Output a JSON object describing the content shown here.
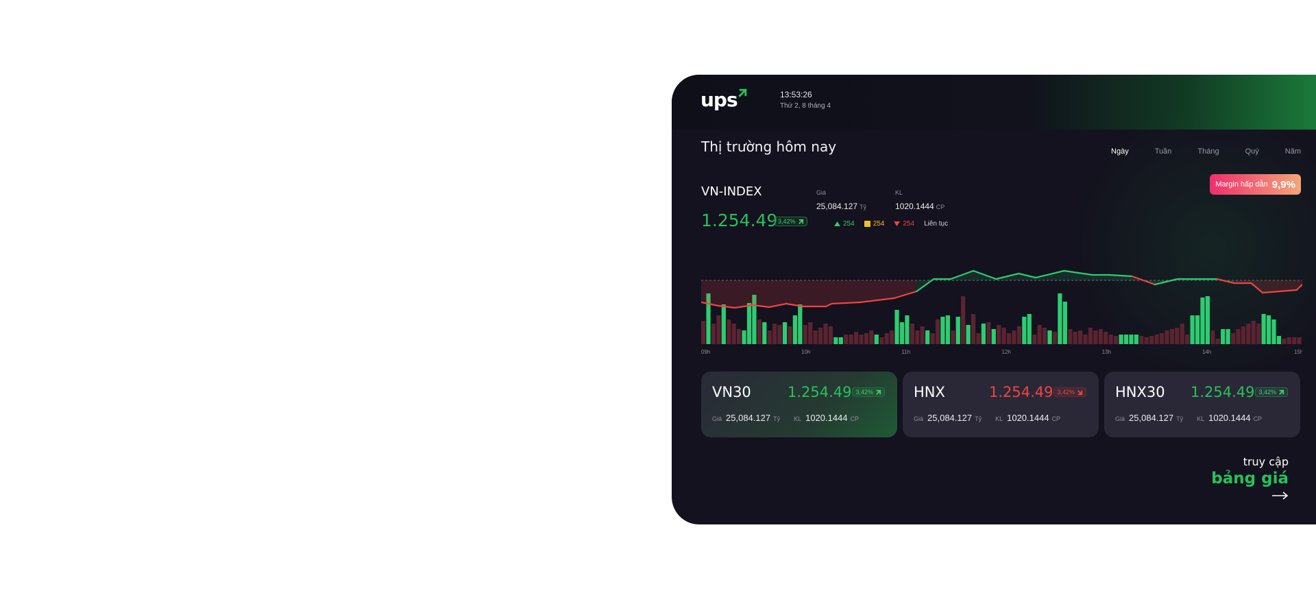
{
  "brand": {
    "logo_text": "ups"
  },
  "header": {
    "time": "13:53:26",
    "date": "Thứ 2, 8 tháng 4"
  },
  "section_title": "Thị trường hôm nay",
  "tabs": [
    {
      "label": "Ngày",
      "active": true
    },
    {
      "label": "Tuần",
      "active": false
    },
    {
      "label": "Tháng",
      "active": false
    },
    {
      "label": "Quý",
      "active": false
    },
    {
      "label": "Năm",
      "active": false
    }
  ],
  "margin_badge": {
    "label": "Margin hấp dẫn",
    "value": "9,9%"
  },
  "main_index": {
    "name": "VN-INDEX",
    "value": "1.254.49",
    "change": "3,42%",
    "direction": "up",
    "price_label": "Giá",
    "price_value": "25,084.127",
    "price_unit": "Tỷ",
    "volume_label": "KL",
    "volume_value": "1020.1444",
    "volume_unit": "CP",
    "up_count": "254",
    "flat_count": "254",
    "down_count": "254",
    "mode_label": "Liên tục"
  },
  "colors": {
    "up": "#2ecc71",
    "down": "#ef4444",
    "flat": "#f4c020",
    "accent": "#27c15b"
  },
  "chart_data": {
    "type": "line",
    "x_ticks": [
      "09h",
      "10h",
      "11h",
      "12h",
      "13h",
      "14h",
      "15h"
    ],
    "reference_line": "dashed",
    "price_line": [
      {
        "x": 0,
        "y": 32,
        "c": "d"
      },
      {
        "x": 3,
        "y": 37,
        "c": "d"
      },
      {
        "x": 6,
        "y": 40,
        "c": "d"
      },
      {
        "x": 9,
        "y": 36,
        "c": "d"
      },
      {
        "x": 12,
        "y": 39,
        "c": "d"
      },
      {
        "x": 15,
        "y": 34,
        "c": "d"
      },
      {
        "x": 18,
        "y": 38,
        "c": "d"
      },
      {
        "x": 22,
        "y": 38,
        "c": "d"
      },
      {
        "x": 23,
        "y": 34,
        "c": "d"
      },
      {
        "x": 28,
        "y": 32,
        "c": "d"
      },
      {
        "x": 34,
        "y": 26,
        "c": "d"
      },
      {
        "x": 38,
        "y": 16,
        "c": "d"
      },
      {
        "x": 41,
        "y": -2,
        "c": "u"
      },
      {
        "x": 44,
        "y": -2,
        "c": "u"
      },
      {
        "x": 48,
        "y": -14,
        "c": "u"
      },
      {
        "x": 52,
        "y": -2,
        "c": "u"
      },
      {
        "x": 56,
        "y": -10,
        "c": "u"
      },
      {
        "x": 59,
        "y": -4,
        "c": "u"
      },
      {
        "x": 64,
        "y": -14,
        "c": "u"
      },
      {
        "x": 69,
        "y": -8,
        "c": "u"
      },
      {
        "x": 72,
        "y": -8,
        "c": "u"
      },
      {
        "x": 76,
        "y": -6,
        "c": "u"
      },
      {
        "x": 80,
        "y": 6,
        "c": "d"
      },
      {
        "x": 84,
        "y": -2,
        "c": "u"
      },
      {
        "x": 88,
        "y": -2,
        "c": "u"
      },
      {
        "x": 91,
        "y": -2,
        "c": "u"
      },
      {
        "x": 94,
        "y": 4,
        "c": "d"
      },
      {
        "x": 97,
        "y": 4,
        "c": "d"
      },
      {
        "x": 99,
        "y": 18,
        "c": "d"
      },
      {
        "x": 102,
        "y": 16,
        "c": "d"
      },
      {
        "x": 105,
        "y": 14,
        "c": "d"
      },
      {
        "x": 106,
        "y": 6,
        "c": "d"
      }
    ],
    "volume": [
      {
        "v": 34,
        "c": "d"
      },
      {
        "v": 74,
        "c": "u"
      },
      {
        "v": 30,
        "c": "d"
      },
      {
        "v": 42,
        "c": "d"
      },
      {
        "v": 58,
        "c": "u"
      },
      {
        "v": 36,
        "c": "d"
      },
      {
        "v": 30,
        "c": "d"
      },
      {
        "v": 22,
        "c": "d"
      },
      {
        "v": 20,
        "c": "u"
      },
      {
        "v": 60,
        "c": "u"
      },
      {
        "v": 72,
        "c": "u"
      },
      {
        "v": 36,
        "c": "d"
      },
      {
        "v": 32,
        "c": "u"
      },
      {
        "v": 20,
        "c": "d"
      },
      {
        "v": 30,
        "c": "d"
      },
      {
        "v": 28,
        "c": "d"
      },
      {
        "v": 32,
        "c": "u"
      },
      {
        "v": 26,
        "c": "d"
      },
      {
        "v": 42,
        "c": "u"
      },
      {
        "v": 58,
        "c": "u"
      },
      {
        "v": 28,
        "c": "d"
      },
      {
        "v": 32,
        "c": "d"
      },
      {
        "v": 20,
        "c": "d"
      },
      {
        "v": 24,
        "c": "d"
      },
      {
        "v": 30,
        "c": "d"
      },
      {
        "v": 26,
        "c": "d"
      },
      {
        "v": 10,
        "c": "u"
      },
      {
        "v": 10,
        "c": "u"
      },
      {
        "v": 14,
        "c": "d"
      },
      {
        "v": 14,
        "c": "d"
      },
      {
        "v": 18,
        "c": "d"
      },
      {
        "v": 14,
        "c": "d"
      },
      {
        "v": 16,
        "c": "d"
      },
      {
        "v": 20,
        "c": "d"
      },
      {
        "v": 14,
        "c": "u"
      },
      {
        "v": 10,
        "c": "d"
      },
      {
        "v": 16,
        "c": "d"
      },
      {
        "v": 20,
        "c": "d"
      },
      {
        "v": 50,
        "c": "u"
      },
      {
        "v": 32,
        "c": "u"
      },
      {
        "v": 42,
        "c": "u"
      },
      {
        "v": 30,
        "c": "d"
      },
      {
        "v": 20,
        "c": "d"
      },
      {
        "v": 26,
        "c": "d"
      },
      {
        "v": 20,
        "c": "u"
      },
      {
        "v": 16,
        "c": "d"
      },
      {
        "v": 36,
        "c": "d"
      },
      {
        "v": 40,
        "c": "u"
      },
      {
        "v": 42,
        "c": "u"
      },
      {
        "v": 20,
        "c": "d"
      },
      {
        "v": 40,
        "c": "u"
      },
      {
        "v": 70,
        "c": "d"
      },
      {
        "v": 28,
        "c": "u"
      },
      {
        "v": 44,
        "c": "d"
      },
      {
        "v": 16,
        "c": "d"
      },
      {
        "v": 30,
        "c": "u"
      },
      {
        "v": 32,
        "c": "d"
      },
      {
        "v": 22,
        "c": "u"
      },
      {
        "v": 28,
        "c": "d"
      },
      {
        "v": 24,
        "c": "d"
      },
      {
        "v": 16,
        "c": "d"
      },
      {
        "v": 20,
        "c": "d"
      },
      {
        "v": 26,
        "c": "d"
      },
      {
        "v": 40,
        "c": "u"
      },
      {
        "v": 44,
        "c": "u"
      },
      {
        "v": 14,
        "c": "d"
      },
      {
        "v": 28,
        "c": "d"
      },
      {
        "v": 24,
        "c": "d"
      },
      {
        "v": 20,
        "c": "u"
      },
      {
        "v": 18,
        "c": "d"
      },
      {
        "v": 74,
        "c": "u"
      },
      {
        "v": 62,
        "c": "u"
      },
      {
        "v": 22,
        "c": "d"
      },
      {
        "v": 18,
        "c": "d"
      },
      {
        "v": 20,
        "c": "d"
      },
      {
        "v": 14,
        "c": "d"
      },
      {
        "v": 24,
        "c": "d"
      },
      {
        "v": 20,
        "c": "d"
      },
      {
        "v": 22,
        "c": "d"
      },
      {
        "v": 18,
        "c": "d"
      },
      {
        "v": 14,
        "c": "d"
      },
      {
        "v": 12,
        "c": "d"
      },
      {
        "v": 14,
        "c": "u"
      },
      {
        "v": 14,
        "c": "u"
      },
      {
        "v": 14,
        "c": "u"
      },
      {
        "v": 14,
        "c": "u"
      },
      {
        "v": 12,
        "c": "d"
      },
      {
        "v": 10,
        "c": "d"
      },
      {
        "v": 12,
        "c": "d"
      },
      {
        "v": 14,
        "c": "d"
      },
      {
        "v": 16,
        "c": "d"
      },
      {
        "v": 20,
        "c": "d"
      },
      {
        "v": 22,
        "c": "d"
      },
      {
        "v": 24,
        "c": "d"
      },
      {
        "v": 30,
        "c": "d"
      },
      {
        "v": 14,
        "c": "d"
      },
      {
        "v": 42,
        "c": "u"
      },
      {
        "v": 42,
        "c": "u"
      },
      {
        "v": 68,
        "c": "u"
      },
      {
        "v": 70,
        "c": "u"
      },
      {
        "v": 20,
        "c": "d"
      },
      {
        "v": 8,
        "c": "d"
      },
      {
        "v": 22,
        "c": "u"
      },
      {
        "v": 22,
        "c": "u"
      },
      {
        "v": 16,
        "c": "d"
      },
      {
        "v": 22,
        "c": "d"
      },
      {
        "v": 26,
        "c": "d"
      },
      {
        "v": 30,
        "c": "d"
      },
      {
        "v": 34,
        "c": "d"
      },
      {
        "v": 30,
        "c": "d"
      },
      {
        "v": 44,
        "c": "u"
      },
      {
        "v": 42,
        "c": "u"
      },
      {
        "v": 36,
        "c": "u"
      },
      {
        "v": 12,
        "c": "u"
      },
      {
        "v": 8,
        "c": "d"
      },
      {
        "v": 10,
        "c": "d"
      },
      {
        "v": 10,
        "c": "d"
      },
      {
        "v": 10,
        "c": "d"
      }
    ]
  },
  "cards": [
    {
      "name": "VN30",
      "value": "1.254.49",
      "change": "3,42%",
      "direction": "up",
      "price_label": "Giá",
      "price_value": "25,084.127",
      "price_unit": "Tỷ",
      "volume_label": "KL",
      "volume_value": "1020.1444",
      "volume_unit": "CP"
    },
    {
      "name": "HNX",
      "value": "1.254.49",
      "change": "3,42%",
      "direction": "down",
      "price_label": "Giá",
      "price_value": "25,084.127",
      "price_unit": "Tỷ",
      "volume_label": "KL",
      "volume_value": "1020.1444",
      "volume_unit": "CP"
    },
    {
      "name": "HNX30",
      "value": "1.254.49",
      "change": "3,42%",
      "direction": "up",
      "price_label": "Giá",
      "price_value": "25,084.127",
      "price_unit": "Tỷ",
      "volume_label": "KL",
      "volume_value": "1020.1444",
      "volume_unit": "CP"
    }
  ],
  "cta": {
    "line1": "truy cập",
    "line2": "bảng giá"
  }
}
